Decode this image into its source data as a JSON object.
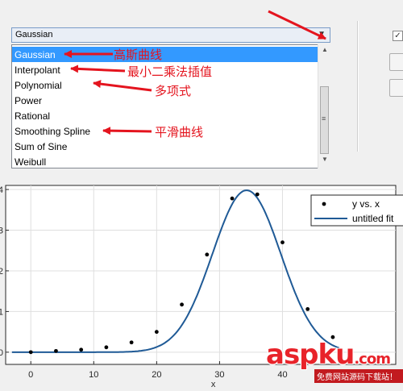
{
  "fit_type_dropdown": {
    "selected": "Gaussian",
    "options": [
      "Gaussian",
      "Interpolant",
      "Polynomial",
      "Power",
      "Rational",
      "Smoothing Spline",
      "Sum of Sine",
      "Weibull"
    ]
  },
  "annotations": {
    "gaussian": "高斯曲线",
    "interpolant": "最小二乘法插值",
    "polynomial": "多项式",
    "smoothing_spline": "平滑曲线"
  },
  "watermark": {
    "brand": "aspku",
    "tld": ".com",
    "tagline": "免费网站源码下载站！"
  },
  "chart_data": {
    "type": "scatter",
    "xlabel": "x",
    "ylabel": "",
    "xlim": [
      -4,
      58
    ],
    "ylim": [
      -0.3,
      4.1
    ],
    "x_ticks": [
      0,
      10,
      20,
      30,
      40
    ],
    "y_ticks": [
      0,
      1,
      2,
      3,
      4
    ],
    "legend_position": "top-right",
    "grid": true,
    "series": [
      {
        "name": "y vs. x",
        "kind": "points",
        "x": [
          0,
          4,
          8,
          12,
          16,
          20,
          24,
          28,
          32,
          36,
          40,
          44,
          48
        ],
        "y": [
          0.0,
          0.03,
          0.06,
          0.12,
          0.24,
          0.5,
          1.17,
          2.4,
          3.78,
          3.88,
          2.7,
          1.06,
          0.37
        ]
      },
      {
        "name": "untitled fit",
        "kind": "fit",
        "model": "gaussian",
        "a": 3.98,
        "b": 34.3,
        "c": 7.7,
        "x_start": -3,
        "x_end": 49
      }
    ],
    "colors": {
      "points": "#000000",
      "fit": "#1f5a96"
    }
  }
}
